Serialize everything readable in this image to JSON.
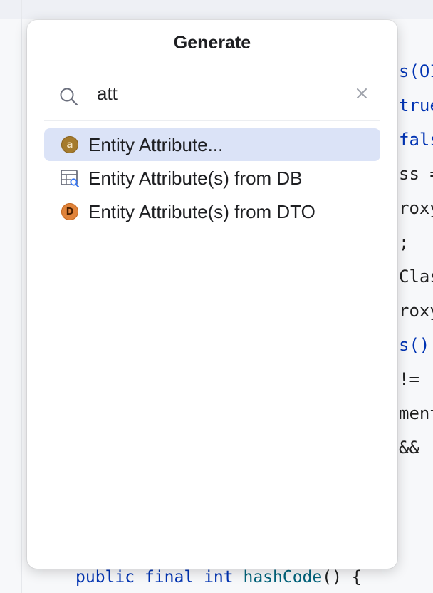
{
  "editor": {
    "code_fragments": [
      "s(OI",
      "true",
      "fals",
      "ss =",
      "roxy",
      ";",
      "Clas",
      "roxy",
      "s()",
      " !=",
      "ment",
      " &&"
    ],
    "bottom_line": {
      "kw1": "public",
      "kw2": "final",
      "kw3": "int",
      "fn": "hashCode",
      "rest": "() {"
    }
  },
  "popup": {
    "title": "Generate",
    "search": {
      "value": "att",
      "search_icon": "search-icon",
      "clear_icon": "close-icon"
    },
    "items": [
      {
        "label": "Entity Attribute...",
        "icon": "attribute-badge-icon",
        "badge_letter": "a",
        "selected": true
      },
      {
        "label": "Entity Attribute(s) from DB",
        "icon": "db-table-icon",
        "selected": false
      },
      {
        "label": "Entity Attribute(s) from DTO",
        "icon": "dto-badge-icon",
        "badge_letter": "D",
        "selected": false
      }
    ]
  },
  "colors": {
    "selection": "#dbe3f7",
    "keyword": "#0033b3",
    "function": "#00627a",
    "badge_attribute": "#a57b2d",
    "badge_dto": "#e0833a"
  }
}
